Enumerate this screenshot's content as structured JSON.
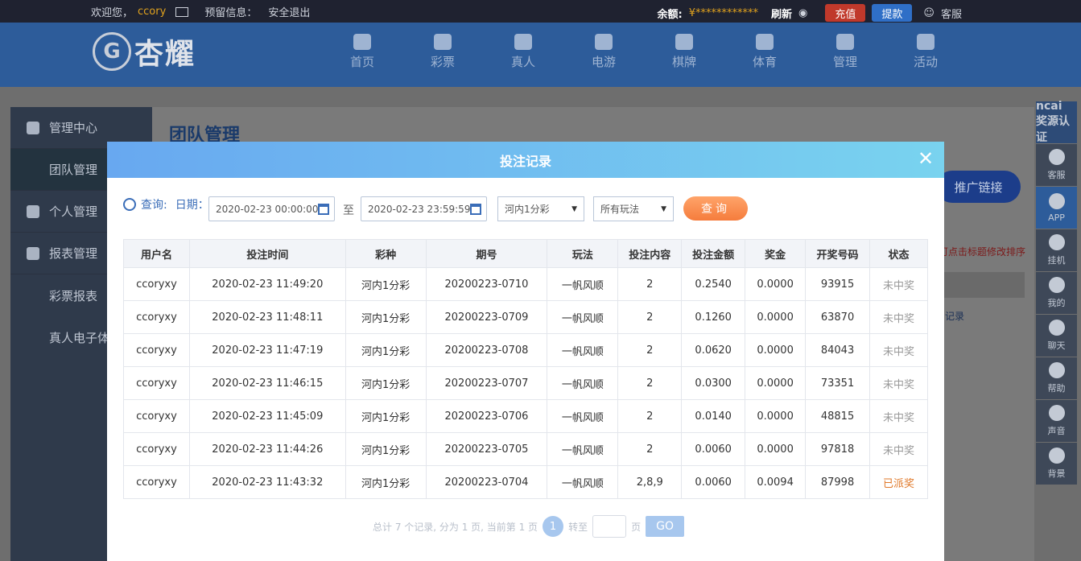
{
  "topbar": {
    "welcome": "欢迎您，",
    "username": "ccory",
    "notice_label": "预留信息：",
    "logout": "安全退出",
    "balance_label": "余额:",
    "balance_value": "¥************",
    "refresh": "刷新",
    "deposit": "充值",
    "withdraw": "提款",
    "service": "客服"
  },
  "brand": {
    "name": "杏耀"
  },
  "nav": [
    "首页",
    "彩票",
    "真人",
    "电游",
    "棋牌",
    "体育",
    "管理",
    "活动"
  ],
  "sidebar": {
    "items": [
      {
        "label": "管理中心"
      },
      {
        "label": "团队管理"
      },
      {
        "label": "个人管理"
      },
      {
        "label": "报表管理"
      },
      {
        "label": "彩票报表"
      },
      {
        "label": "真人电子体"
      }
    ]
  },
  "content": {
    "title": "团队管理",
    "promo": "推广链接",
    "hint": "可点击标题修改排序",
    "record_link": "记录"
  },
  "rightbar": [
    "ncai 奖源认证",
    "客服",
    "APP",
    "挂机",
    "我的",
    "聊天",
    "帮助",
    "声音",
    "背景"
  ],
  "modal": {
    "title": "投注记录",
    "query_label": "查询:",
    "date_label": "日期：",
    "start_date": "2020-02-23 00:00:00",
    "to": "至",
    "end_date": "2020-02-23 23:59:59",
    "lottery_select": "河内1分彩",
    "play_select": "所有玩法",
    "query_button": "查询",
    "columns": [
      "用户名",
      "投注时间",
      "彩种",
      "期号",
      "玩法",
      "投注内容",
      "投注金额",
      "奖金",
      "开奖号码",
      "状态"
    ],
    "rows": [
      [
        "ccoryxy",
        "2020-02-23 11:49:20",
        "河内1分彩",
        "20200223-0710",
        "一帆风顺",
        "2",
        "0.2540",
        "0.0000",
        "93915",
        "未中奖"
      ],
      [
        "ccoryxy",
        "2020-02-23 11:48:11",
        "河内1分彩",
        "20200223-0709",
        "一帆风顺",
        "2",
        "0.1260",
        "0.0000",
        "63870",
        "未中奖"
      ],
      [
        "ccoryxy",
        "2020-02-23 11:47:19",
        "河内1分彩",
        "20200223-0708",
        "一帆风顺",
        "2",
        "0.0620",
        "0.0000",
        "84043",
        "未中奖"
      ],
      [
        "ccoryxy",
        "2020-02-23 11:46:15",
        "河内1分彩",
        "20200223-0707",
        "一帆风顺",
        "2",
        "0.0300",
        "0.0000",
        "73351",
        "未中奖"
      ],
      [
        "ccoryxy",
        "2020-02-23 11:45:09",
        "河内1分彩",
        "20200223-0706",
        "一帆风顺",
        "2",
        "0.0140",
        "0.0000",
        "48815",
        "未中奖"
      ],
      [
        "ccoryxy",
        "2020-02-23 11:44:26",
        "河内1分彩",
        "20200223-0705",
        "一帆风顺",
        "2",
        "0.0060",
        "0.0000",
        "97818",
        "未中奖"
      ],
      [
        "ccoryxy",
        "2020-02-23 11:43:32",
        "河内1分彩",
        "20200223-0704",
        "一帆风顺",
        "2,8,9",
        "0.0060",
        "0.0094",
        "87998",
        "已派奖"
      ]
    ],
    "pager": {
      "summary": "总计 7 个记录, 分为 1 页, 当前第 1 页",
      "current": "1",
      "goto": "转至",
      "page_unit": "页",
      "go": "GO"
    }
  }
}
